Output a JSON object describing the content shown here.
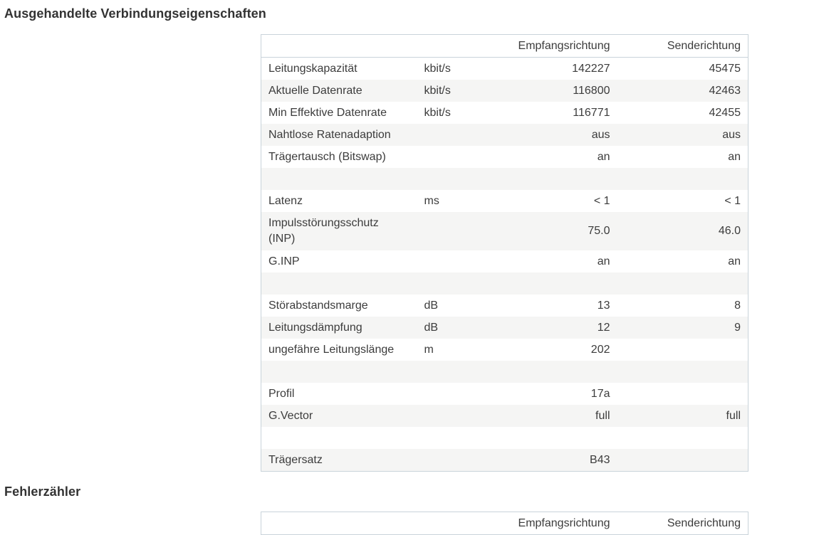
{
  "sections": {
    "properties_title": "Ausgehandelte Verbindungseigenschaften",
    "errors_title": "Fehlerzähler"
  },
  "table": {
    "header": {
      "label": "",
      "unit": "",
      "rx": "Empfangsrichtung",
      "tx": "Senderichtung"
    },
    "rows": [
      {
        "label": "Leitungskapazität",
        "unit": "kbit/s",
        "rx": "142227",
        "tx": "45475"
      },
      {
        "label": "Aktuelle Datenrate",
        "unit": "kbit/s",
        "rx": "116800",
        "tx": "42463"
      },
      {
        "label": "Min Effektive Datenrate",
        "unit": "kbit/s",
        "rx": "116771",
        "tx": "42455"
      },
      {
        "label": "Nahtlose Ratenadaption",
        "unit": "",
        "rx": "aus",
        "tx": "aus"
      },
      {
        "label": "Trägertausch (Bitswap)",
        "unit": "",
        "rx": "an",
        "tx": "an"
      },
      {
        "label": "",
        "unit": "",
        "rx": "",
        "tx": ""
      },
      {
        "label": "Latenz",
        "unit": "ms",
        "rx": "< 1",
        "tx": "< 1"
      },
      {
        "label": "Impulsstörungsschutz (INP)",
        "unit": "",
        "rx": "75.0",
        "tx": "46.0"
      },
      {
        "label": "G.INP",
        "unit": "",
        "rx": "an",
        "tx": "an"
      },
      {
        "label": "",
        "unit": "",
        "rx": "",
        "tx": ""
      },
      {
        "label": "Störabstandsmarge",
        "unit": "dB",
        "rx": "13",
        "tx": "8"
      },
      {
        "label": "Leitungsdämpfung",
        "unit": "dB",
        "rx": "12",
        "tx": "9"
      },
      {
        "label": "ungefähre Leitungslänge",
        "unit": "m",
        "rx": "202",
        "tx": ""
      },
      {
        "label": "",
        "unit": "",
        "rx": "",
        "tx": ""
      },
      {
        "label": "Profil",
        "unit": "",
        "rx": "17a",
        "tx": ""
      },
      {
        "label": "G.Vector",
        "unit": "",
        "rx": "full",
        "tx": "full"
      },
      {
        "label": "",
        "unit": "",
        "rx": "",
        "tx": ""
      },
      {
        "label": "Trägersatz",
        "unit": "",
        "rx": "B43",
        "tx": ""
      }
    ]
  },
  "error_table": {
    "header": {
      "rx": "Empfangsrichtung",
      "tx": "Senderichtung"
    }
  }
}
